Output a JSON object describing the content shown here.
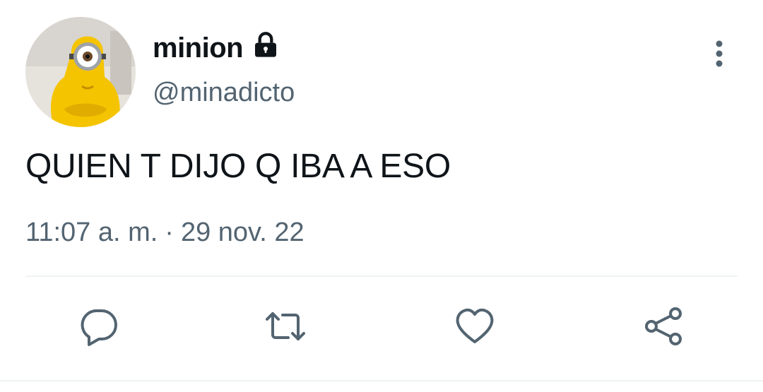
{
  "tweet": {
    "display_name": "minion",
    "handle": "@minadicto",
    "text": "QUIEN T DIJO Q IBA A ESO",
    "time": "11:07 a. m.",
    "separator": "·",
    "date": "29 nov. 22"
  },
  "icons": {
    "lock": "lock-icon",
    "more": "more-vertical-icon",
    "reply": "reply-icon",
    "retweet": "retweet-icon",
    "like": "heart-icon",
    "share": "share-icon"
  },
  "colors": {
    "text_primary": "#0f1419",
    "text_secondary": "#536471",
    "icon": "#536471",
    "divider": "#eff3f4",
    "avatar_yellow": "#f5c400"
  }
}
